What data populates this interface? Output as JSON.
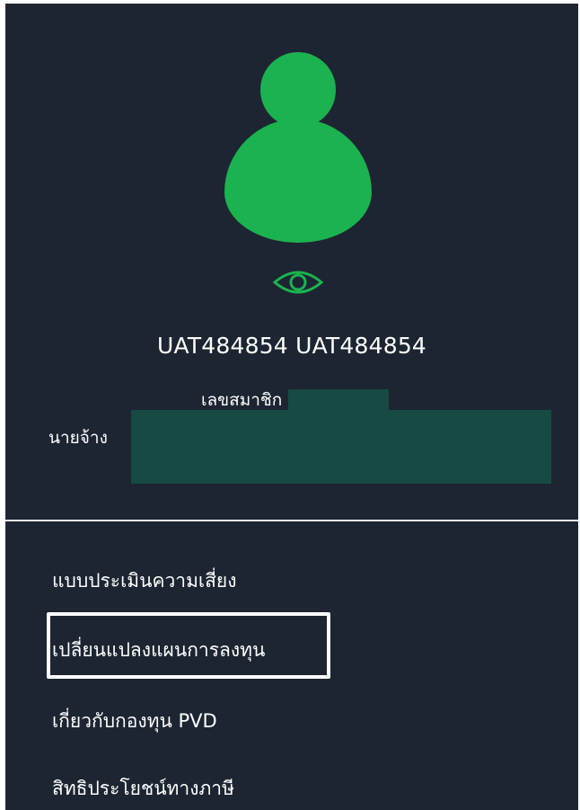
{
  "theme": {
    "background": "#1d2532",
    "accent": "#1bb350",
    "redaction": "#174a42",
    "text": "#ffffff"
  },
  "profile": {
    "avatar_icon": "user-avatar-icon",
    "visibility_icon": "eye-icon",
    "name": "UAT484854 UAT484854",
    "member_label": "เลขสมาชิก",
    "member_value": "",
    "employer_label": "นายจ้าง",
    "employer_value": ""
  },
  "menu": {
    "items": [
      {
        "label": "แบบประเมินความเสี่ยง"
      },
      {
        "label": "เปลี่ยนแปลงแผนการลงทุน",
        "highlighted": true
      },
      {
        "label": "เกี่ยวกับกองทุน PVD"
      },
      {
        "label": "สิทธิประโยชน์ทางภาษี"
      }
    ]
  }
}
